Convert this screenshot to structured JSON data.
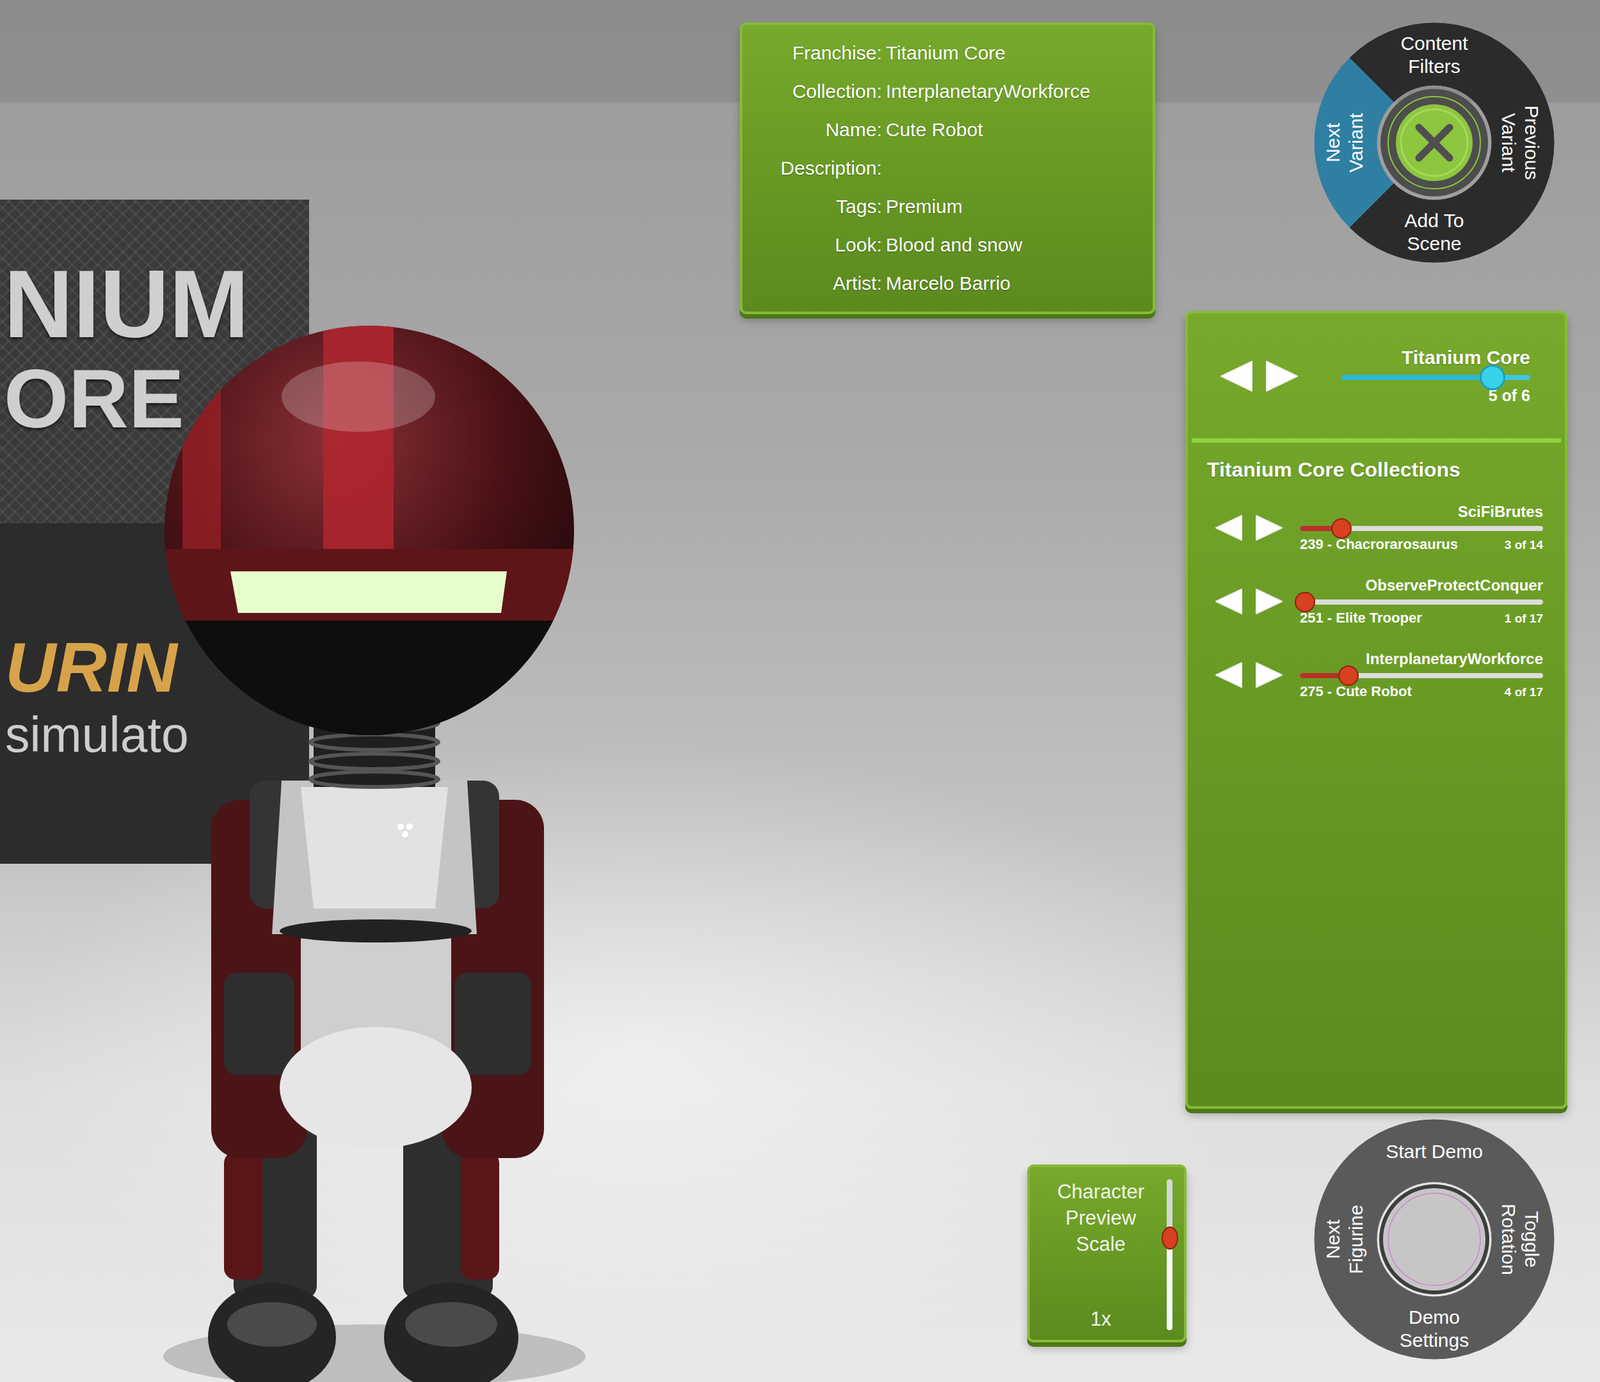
{
  "scene": {
    "poster": {
      "top_lines": [
        "NIUM",
        "ORE"
      ],
      "bottom_lines": [
        "URIN",
        "simulato"
      ]
    }
  },
  "info_panel": {
    "rows": [
      {
        "label": "Franchise:",
        "value": "Titanium Core"
      },
      {
        "label": "Collection:",
        "value": "InterplanetaryWorkforce"
      },
      {
        "label": "Name:",
        "value": "Cute Robot"
      },
      {
        "label": "Description:"
      },
      {
        "label": "Tags:",
        "value": "Premium"
      },
      {
        "label": "Look:",
        "value": "Blood and snow"
      },
      {
        "label": "Artist:",
        "value": "Marcelo Barrio"
      }
    ]
  },
  "variant_menu": {
    "segments": [
      {
        "label": "Content Filters",
        "selected": false
      },
      {
        "label": "Previous Variant",
        "selected": false
      },
      {
        "label": "Add To Scene",
        "selected": false
      },
      {
        "label": "Next Variant",
        "selected": true
      }
    ]
  },
  "franchise": {
    "title": "Titanium Core",
    "level": 0.8,
    "reading": "5 of 6"
  },
  "collections": {
    "heading": "Titanium Core Collections",
    "items": [
      {
        "name": "SciFiBrutes",
        "item": "239 - Chacrorarosaurus",
        "count": "3 of 14",
        "level": 0.17
      },
      {
        "name": "ObserveProtectConquer",
        "item": "251 - Elite Trooper",
        "count": "1 of 17",
        "level": 0.02
      },
      {
        "name": "InterplanetaryWorkforce",
        "item": "275 - Cute Robot",
        "count": "4 of 17",
        "level": 0.2
      }
    ]
  },
  "scale": {
    "label": "Character Preview Scale",
    "reading": "1x",
    "level": 0.61
  },
  "demo_menu": {
    "segments": [
      {
        "label": "Start Demo"
      },
      {
        "label": "Toggle Rotation"
      },
      {
        "label": "Demo Settings"
      },
      {
        "label": "Next Figurine"
      }
    ]
  }
}
